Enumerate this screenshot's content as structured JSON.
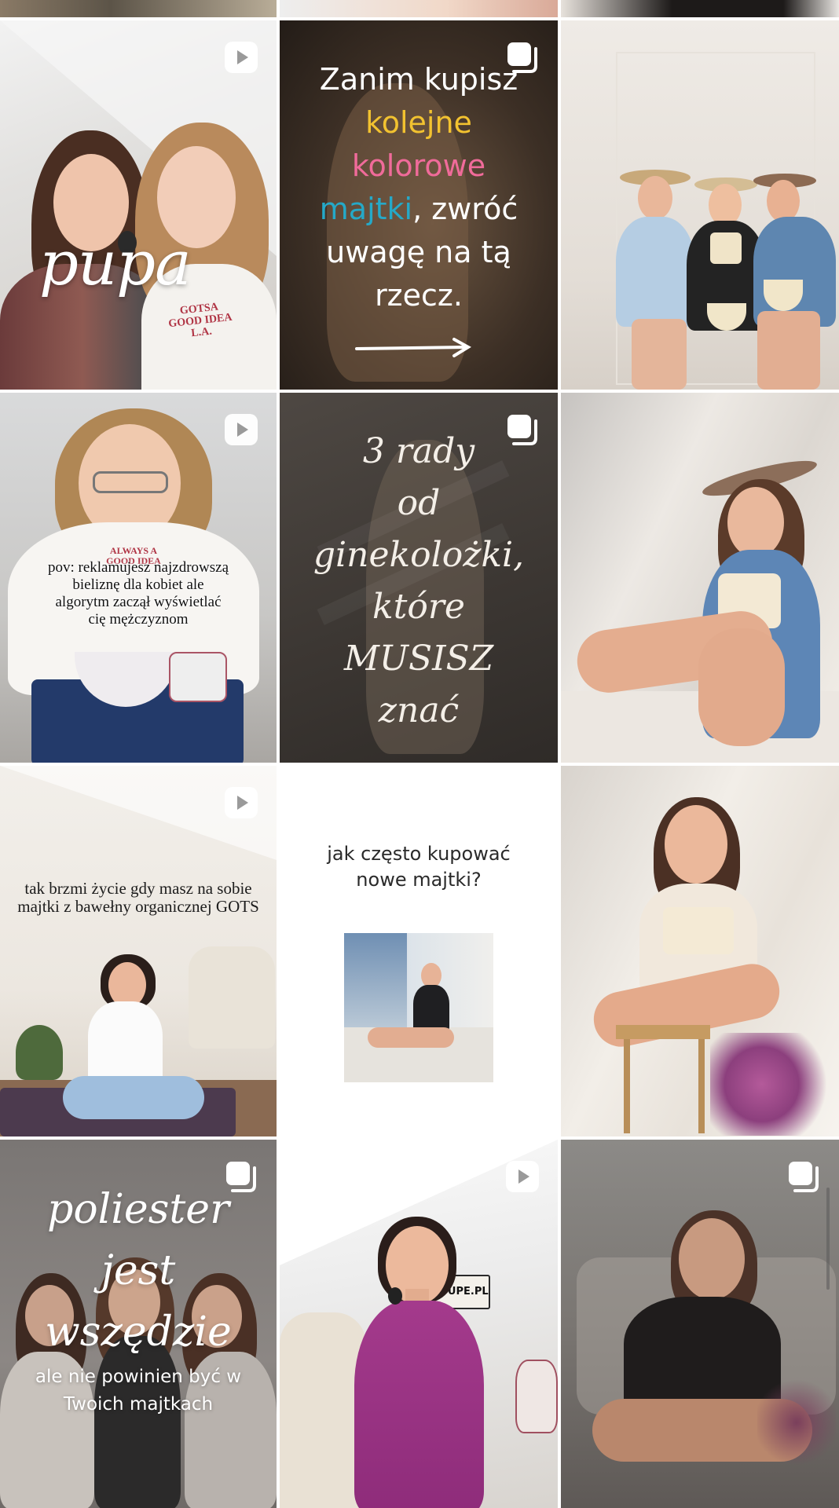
{
  "grid": {
    "tiles": [
      {
        "name": "tile-partial-1",
        "type": "post"
      },
      {
        "name": "tile-partial-2",
        "type": "post"
      },
      {
        "name": "tile-partial-3",
        "type": "post"
      },
      {
        "name": "tile-pupa-video",
        "type": "reel",
        "overlay": "pupa"
      },
      {
        "name": "tile-zanim-kupisz",
        "type": "carousel"
      },
      {
        "name": "tile-three-women-hats",
        "type": "post"
      },
      {
        "name": "tile-pov-reel",
        "type": "reel"
      },
      {
        "name": "tile-3-rady",
        "type": "carousel"
      },
      {
        "name": "tile-woman-denim-hat",
        "type": "post"
      },
      {
        "name": "tile-tak-brzmi-reel",
        "type": "reel"
      },
      {
        "name": "tile-jak-czesto",
        "type": "post"
      },
      {
        "name": "tile-woman-chair",
        "type": "post"
      },
      {
        "name": "tile-poliester",
        "type": "carousel"
      },
      {
        "name": "tile-pink-top-reel",
        "type": "reel"
      },
      {
        "name": "tile-black-top",
        "type": "carousel"
      }
    ]
  },
  "posts": {
    "pupa": {
      "overlay": "pupa",
      "shirt": "GOTSA\nGOOD IDEA\nL.A."
    },
    "zanim": {
      "line1": "Zanim kupisz",
      "line2": "kolejne",
      "line3": "kolorowe",
      "line4a": "majtki",
      "line4b": ", zwróć",
      "line5": "uwagę na tą",
      "line6": "rzecz."
    },
    "rady": {
      "l1": "3 rady",
      "l2": "od",
      "l3": "ginekolożki,",
      "l4": "które",
      "l5": "MUSISZ",
      "l6": "znać"
    },
    "pov": {
      "shirt": "ALWAYS A\nGOOD IDEA",
      "text": "pov: reklamujesz najzdrowszą bieliznę dla kobiet ale algorytm zaczął wyświetlać cię mężczyznom"
    },
    "brzmi": {
      "text": "tak brzmi życie gdy masz na sobie majtki z bawełny organicznej GOTS"
    },
    "jak": {
      "l1": "jak często kupować",
      "l2": "nowe majtki?"
    },
    "poli": {
      "l1": "poliester",
      "l2": "jest",
      "l3": "wszędzie",
      "sub1": "ale nie powinien być w",
      "sub2": "Twoich majtkach"
    },
    "pinktop": {
      "sign": "APUPE.PL"
    }
  },
  "colors": {
    "play_badge_bg": "#ffffff",
    "carousel_badge": "#ffffff",
    "zanim_yellow": "#f2c230",
    "zanim_pink": "#f06b9a",
    "zanim_blue": "#25a9c8"
  },
  "icons": {
    "reel": "play-icon",
    "carousel": "carousel-icon"
  }
}
